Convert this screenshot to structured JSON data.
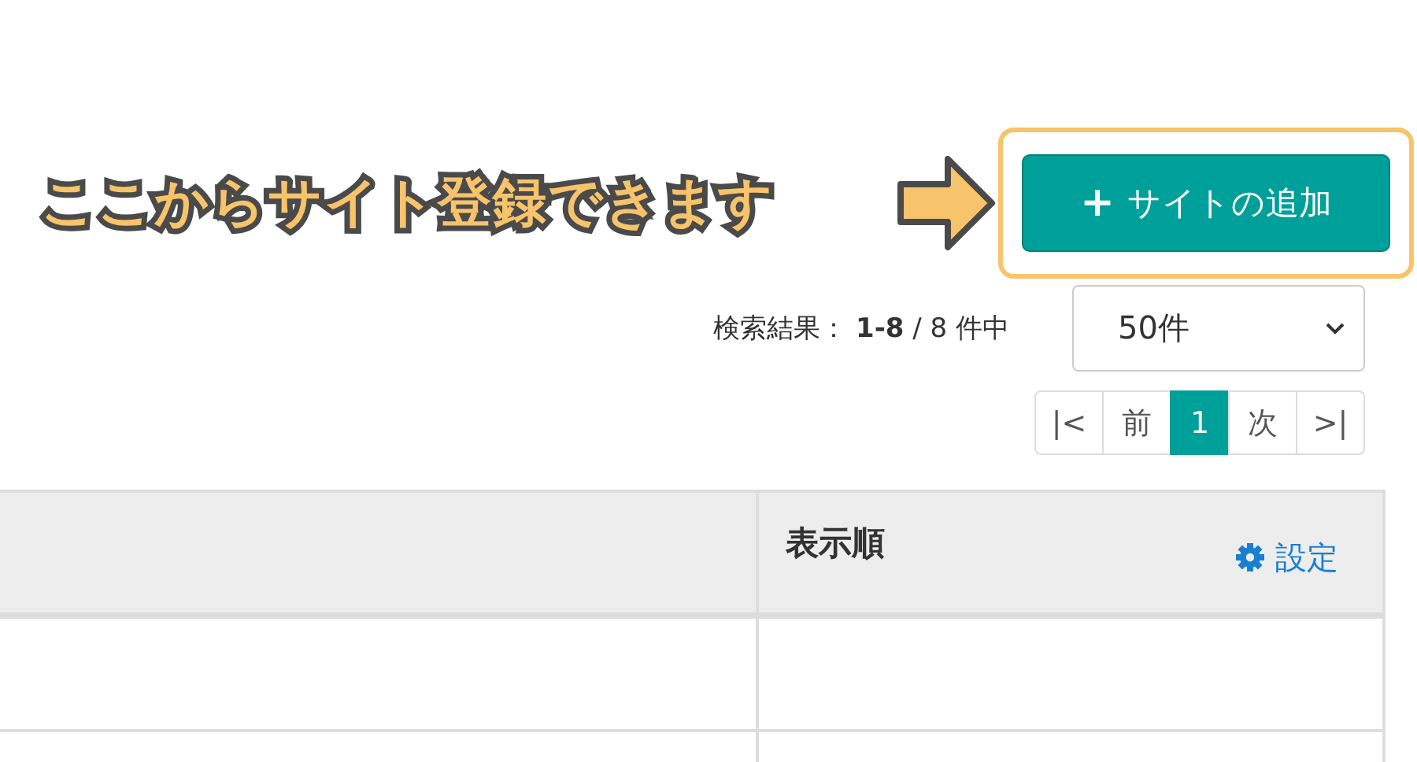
{
  "annotation": {
    "text": "ここからサイト登録できます",
    "highlighted": true
  },
  "add_button": {
    "icon": "+",
    "label": "サイトの追加"
  },
  "results": {
    "text": "検索結果： **1-8** / 8 件中"
  },
  "per_page": {
    "value": "50件"
  },
  "pagination": [
    {
      "label": "|<",
      "selected": false
    },
    {
      "label": "前",
      "selected": false
    },
    {
      "label": "1",
      "selected": true
    },
    {
      "label": "次",
      "selected": false
    },
    {
      "label": ">|",
      "selected": false
    }
  ],
  "table": {
    "columns": [
      {
        "label": "表示順",
        "settings_link": "設定"
      }
    ]
  }
}
